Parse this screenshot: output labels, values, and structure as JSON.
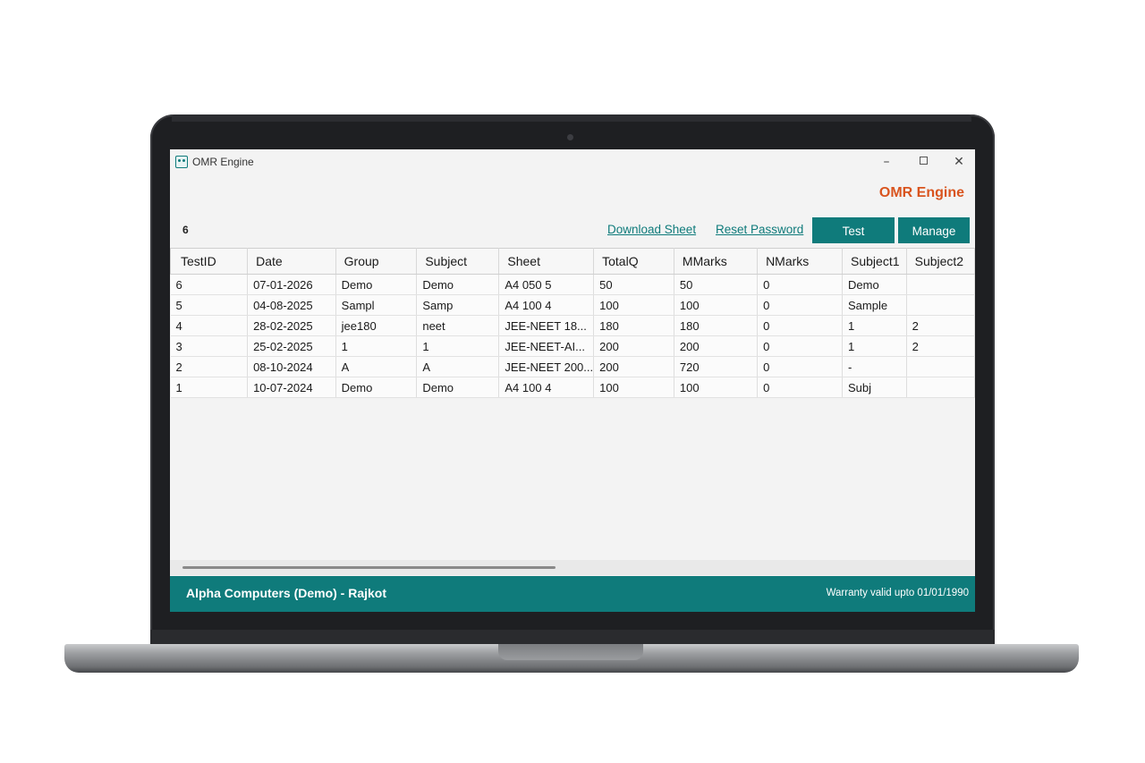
{
  "window": {
    "title": "OMR Engine",
    "controls": {
      "minimize": "–",
      "close": "✕"
    }
  },
  "header": {
    "brand": "OMR Engine",
    "count": "6",
    "links": {
      "download_sheet": "Download Sheet",
      "reset_password": "Reset Password"
    },
    "buttons": {
      "test": "Test",
      "manage": "Manage"
    }
  },
  "table": {
    "columns": [
      "TestID",
      "Date",
      "Group",
      "Subject",
      "Sheet",
      "TotalQ",
      "MMarks",
      "NMarks",
      "Subject1",
      "Subject2"
    ],
    "rows": [
      [
        "6",
        "07-01-2026",
        "Demo",
        "Demo",
        "A4 050 5",
        "50",
        "50",
        "0",
        "Demo",
        ""
      ],
      [
        "5",
        "04-08-2025",
        "Sampl",
        "Samp",
        "A4 100 4",
        "100",
        "100",
        "0",
        "Sample",
        ""
      ],
      [
        "4",
        "28-02-2025",
        "jee180",
        "neet",
        "JEE-NEET 18...",
        "180",
        "180",
        "0",
        "1",
        "2"
      ],
      [
        "3",
        "25-02-2025",
        "1",
        "1",
        "JEE-NEET-AI...",
        "200",
        "200",
        "0",
        "1",
        "2"
      ],
      [
        "2",
        "08-10-2024",
        "A",
        "A",
        "JEE-NEET 200...",
        "200",
        "720",
        "0",
        "-",
        ""
      ],
      [
        "1",
        "10-07-2024",
        "Demo",
        "Demo",
        "A4 100 4",
        "100",
        "100",
        "0",
        "Subj",
        ""
      ]
    ]
  },
  "footer": {
    "company": "Alpha Computers (Demo) - Rajkot",
    "warranty": "Warranty valid upto 01/01/1990"
  },
  "colors": {
    "accent": "#0f7b7b",
    "brand": "#d9541e"
  }
}
